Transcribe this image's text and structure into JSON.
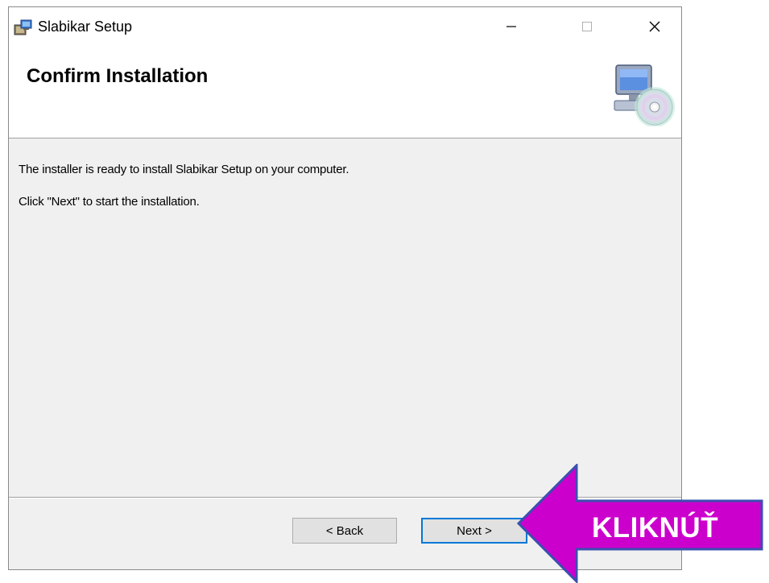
{
  "window": {
    "title": "Slabikar Setup",
    "controls": {
      "minimize": "minimize",
      "maximize": "maximize",
      "close": "close"
    }
  },
  "banner": {
    "title": "Confirm Installation"
  },
  "content": {
    "message_ready": "The installer is ready to install Slabikar Setup on your computer.",
    "message_click": "Click \"Next\" to start the installation."
  },
  "buttons": {
    "back_label": "< Back",
    "next_label": "Next >"
  },
  "annotation": {
    "label": "KLIKNÚŤ",
    "fill_color": "#cc00cc",
    "border_color": "#3a4fb0"
  },
  "colors": {
    "focus_border": "#0078d7",
    "button_face": "#e1e1e1",
    "dialog_bg": "#f0f0f0"
  }
}
